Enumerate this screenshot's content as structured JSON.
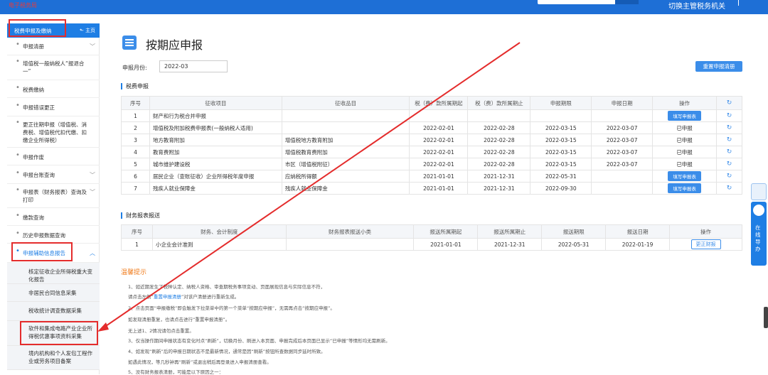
{
  "header": {
    "logo_text": "电子税务局",
    "region_label": "切换主管税务机关"
  },
  "sidebar": {
    "title": "税费申报及缴纳",
    "home_label": "主页",
    "items": [
      {
        "label": "申报清册",
        "chevron": "﹀"
      },
      {
        "label": "增值税一般纳税人“报退合一”",
        "chevron": ""
      },
      {
        "label": "税费缴纳",
        "chevron": ""
      },
      {
        "label": "申报错误更正",
        "chevron": ""
      },
      {
        "label": "更正往期申报（增值税、消费税、增值税代扣代缴、扣缴企业所得税）",
        "chevron": ""
      },
      {
        "label": "申报作废",
        "chevron": ""
      },
      {
        "label": "申报台账查询",
        "chevron": "﹀"
      },
      {
        "label": "申报表（财务报表）查询及打印",
        "chevron": "﹀"
      },
      {
        "label": "缴款查询",
        "chevron": ""
      },
      {
        "label": "历史申报数据查询",
        "chevron": ""
      },
      {
        "label": "申报辅助信息报告",
        "chevron": "︿"
      }
    ],
    "subitems": [
      {
        "label": "核定征收企业所得税重大变化报告"
      },
      {
        "label": "非居民合同信息采集"
      },
      {
        "label": "税收统计调查数据采集"
      },
      {
        "label": "软件和集成电路产业企业所得税优惠事项资料采集"
      },
      {
        "label": "境内机构和个人发包工程作业或劳务项目备案"
      }
    ]
  },
  "main": {
    "title": "按期应申报",
    "month_label": "申报月份:",
    "month_value": "2022-03",
    "reset_button": "重置申报清册",
    "tax_section": "税费申报",
    "tax_headers": [
      "序号",
      "征收项目",
      "征收品目",
      "税（费）款所属期起",
      "税（费）款所属期止",
      "申报期限",
      "申报日期",
      "操作"
    ],
    "tax_rows": [
      {
        "no": "1",
        "item": "财产和行为税合并申报",
        "sub": "",
        "start": "",
        "end": "",
        "deadline": "",
        "date": "",
        "op": "填写申报表",
        "op_type": "button"
      },
      {
        "no": "2",
        "item": "增值税及附加税费申报表(一般纳税人适用)",
        "sub": "",
        "start": "2022-02-01",
        "end": "2022-02-28",
        "deadline": "2022-03-15",
        "date": "2022-03-07",
        "op": "已申报",
        "op_type": "text"
      },
      {
        "no": "3",
        "item": "地方教育附加",
        "sub": "增值税地方教育附加",
        "start": "2022-02-01",
        "end": "2022-02-28",
        "deadline": "2022-03-15",
        "date": "2022-03-07",
        "op": "已申报",
        "op_type": "text"
      },
      {
        "no": "4",
        "item": "教育费附加",
        "sub": "增值税教育费附加",
        "start": "2022-02-01",
        "end": "2022-02-28",
        "deadline": "2022-03-15",
        "date": "2022-03-07",
        "op": "已申报",
        "op_type": "text"
      },
      {
        "no": "5",
        "item": "城市维护建设税",
        "sub": "市区（增值税附征）",
        "start": "2022-02-01",
        "end": "2022-02-28",
        "deadline": "2022-03-15",
        "date": "2022-03-07",
        "op": "已申报",
        "op_type": "text"
      },
      {
        "no": "6",
        "item": "居民企业（查账征收）企业所得税年度申报",
        "sub": "应纳税所得额",
        "start": "2021-01-01",
        "end": "2021-12-31",
        "deadline": "2022-05-31",
        "date": "",
        "op": "填写申报表",
        "op_type": "button"
      },
      {
        "no": "7",
        "item": "残疾人就业保障金",
        "sub": "残疾人就业保障金",
        "start": "2021-01-01",
        "end": "2021-12-31",
        "deadline": "2022-09-30",
        "date": "",
        "op": "填写申报表",
        "op_type": "button"
      }
    ],
    "fin_section": "财务报表报送",
    "fin_headers": [
      "序号",
      "财务、会计制度",
      "财务报表报送小类",
      "报送所属期起",
      "报送所属期止",
      "报送期限",
      "报送日期",
      "操作"
    ],
    "fin_rows": [
      {
        "no": "1",
        "system": "小企业会计准则",
        "sub": "",
        "start": "2021-01-01",
        "end": "2021-12-31",
        "deadline": "2022-05-31",
        "date": "2022-01-19",
        "op": "更正财报"
      }
    ],
    "tips_title": "温馨提示",
    "tips": [
      {
        "pre": "1、如近期发生了税种认定、纳税人资格、审查期税务事项变动、页面展现信息与实际信息不符，",
        "link": "",
        "post": ""
      },
      {
        "pre": "请点击左侧“",
        "link": "重置申报清册",
        "post": "”对该户清册进行重新生成。"
      },
      {
        "pre": "2、点击页面“申报缴税”即会触发下拉菜单中的第一个菜单“按期应申报”，无需再点击“按期应申报”。",
        "link": "",
        "post": ""
      },
      {
        "pre": "如发现清册重复，也请点击进行“重置申报清册”。",
        "link": "",
        "post": ""
      },
      {
        "pre": "无上述1、2情况请勿点击重置。",
        "link": "",
        "post": ""
      },
      {
        "pre": "3、仅当操作期间申报状态有变化时点“刷新”，切换月份、刷进入本页面、申报完成后本页面已显示“已申报”等情形均无需刷新。",
        "link": "",
        "post": ""
      },
      {
        "pre": "4、如发现“刷新”后的申报日期状态不是最新情况，通常是因“刷新”按钮所查数据同步延时所致。",
        "link": "",
        "post": ""
      },
      {
        "pre": "如遇此情况，等几秒钟再“刷新”或退出稍后再登录进入申报清册查看。",
        "link": "",
        "post": ""
      },
      {
        "pre": "5、没有财务报表清册，可能是以下原因之一：",
        "link": "",
        "post": ""
      }
    ]
  },
  "float_service": {
    "label": "在线导办"
  },
  "colors": {
    "primary": "#1e7ee4",
    "highlight": "#e42c2c",
    "tips": "#f07c1d"
  }
}
